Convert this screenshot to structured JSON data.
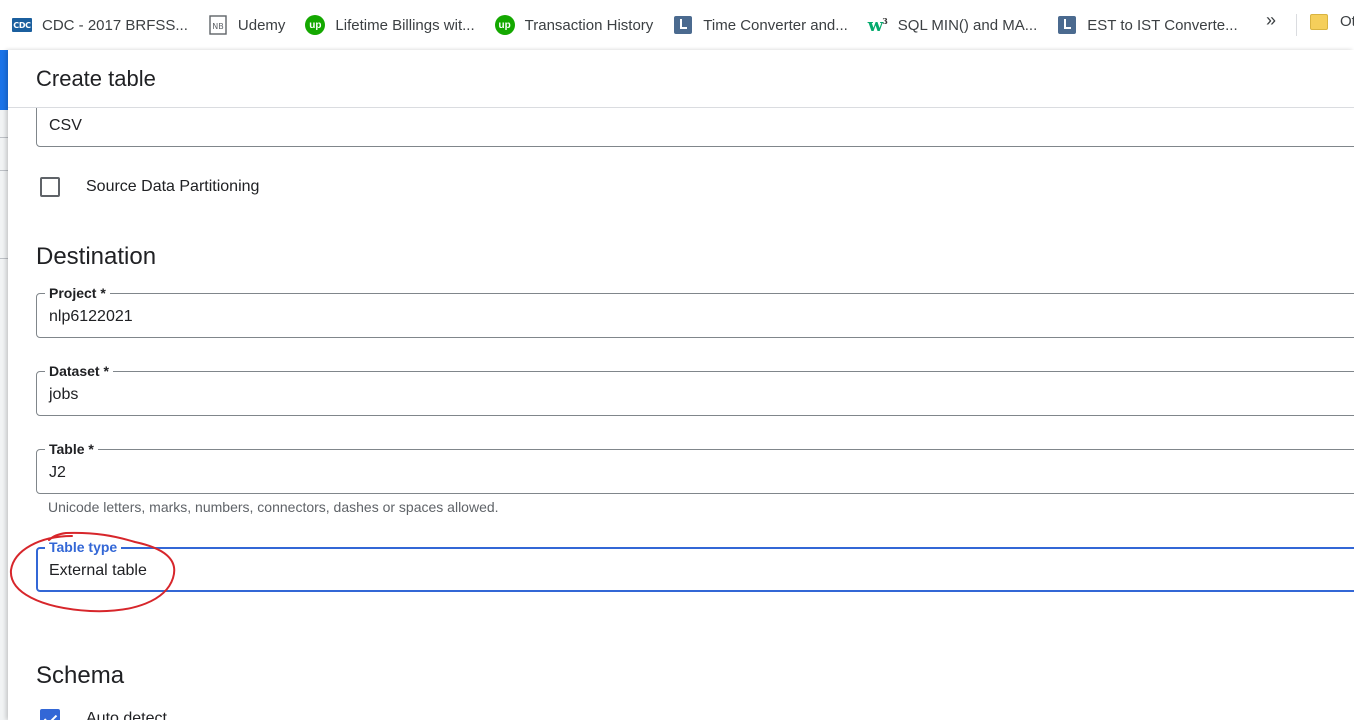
{
  "bookmarks": [
    {
      "label": "CDC - 2017 BRFSS...",
      "icon": "cdc-icon"
    },
    {
      "label": "Udemy",
      "icon": "notebook-icon"
    },
    {
      "label": "Lifetime Billings wit...",
      "icon": "upwork-icon"
    },
    {
      "label": "Transaction History",
      "icon": "upwork-icon"
    },
    {
      "label": "Time Converter and...",
      "icon": "clock-icon"
    },
    {
      "label": "SQL MIN() and MA...",
      "icon": "w3schools-icon"
    },
    {
      "label": "EST to IST Converte...",
      "icon": "clock-icon"
    }
  ],
  "bookmarks_more": "»",
  "other_bookmarks": "Ot",
  "icon_text": {
    "cdc": "CDC",
    "upwork": "up",
    "w3": "w",
    "w3_sup": "3"
  },
  "panel": {
    "title": "Create table"
  },
  "source": {
    "file_format_value": "CSV",
    "partitioning_label": "Source Data Partitioning",
    "partitioning_checked": false
  },
  "destination": {
    "heading": "Destination",
    "project_label": "Project *",
    "project_value": "nlp6122021",
    "dataset_label": "Dataset *",
    "dataset_value": "jobs",
    "table_label": "Table *",
    "table_value": "J2",
    "table_hint": "Unicode letters, marks, numbers, connectors, dashes or spaces allowed.",
    "table_type_label": "Table type",
    "table_type_value": "External table"
  },
  "schema": {
    "heading": "Schema",
    "auto_detect_label": "Auto detect",
    "auto_detect_checked": true
  },
  "colors": {
    "focus_blue": "#3367d6",
    "annotation_red": "#d7262b",
    "upwork_green": "#14a800"
  }
}
